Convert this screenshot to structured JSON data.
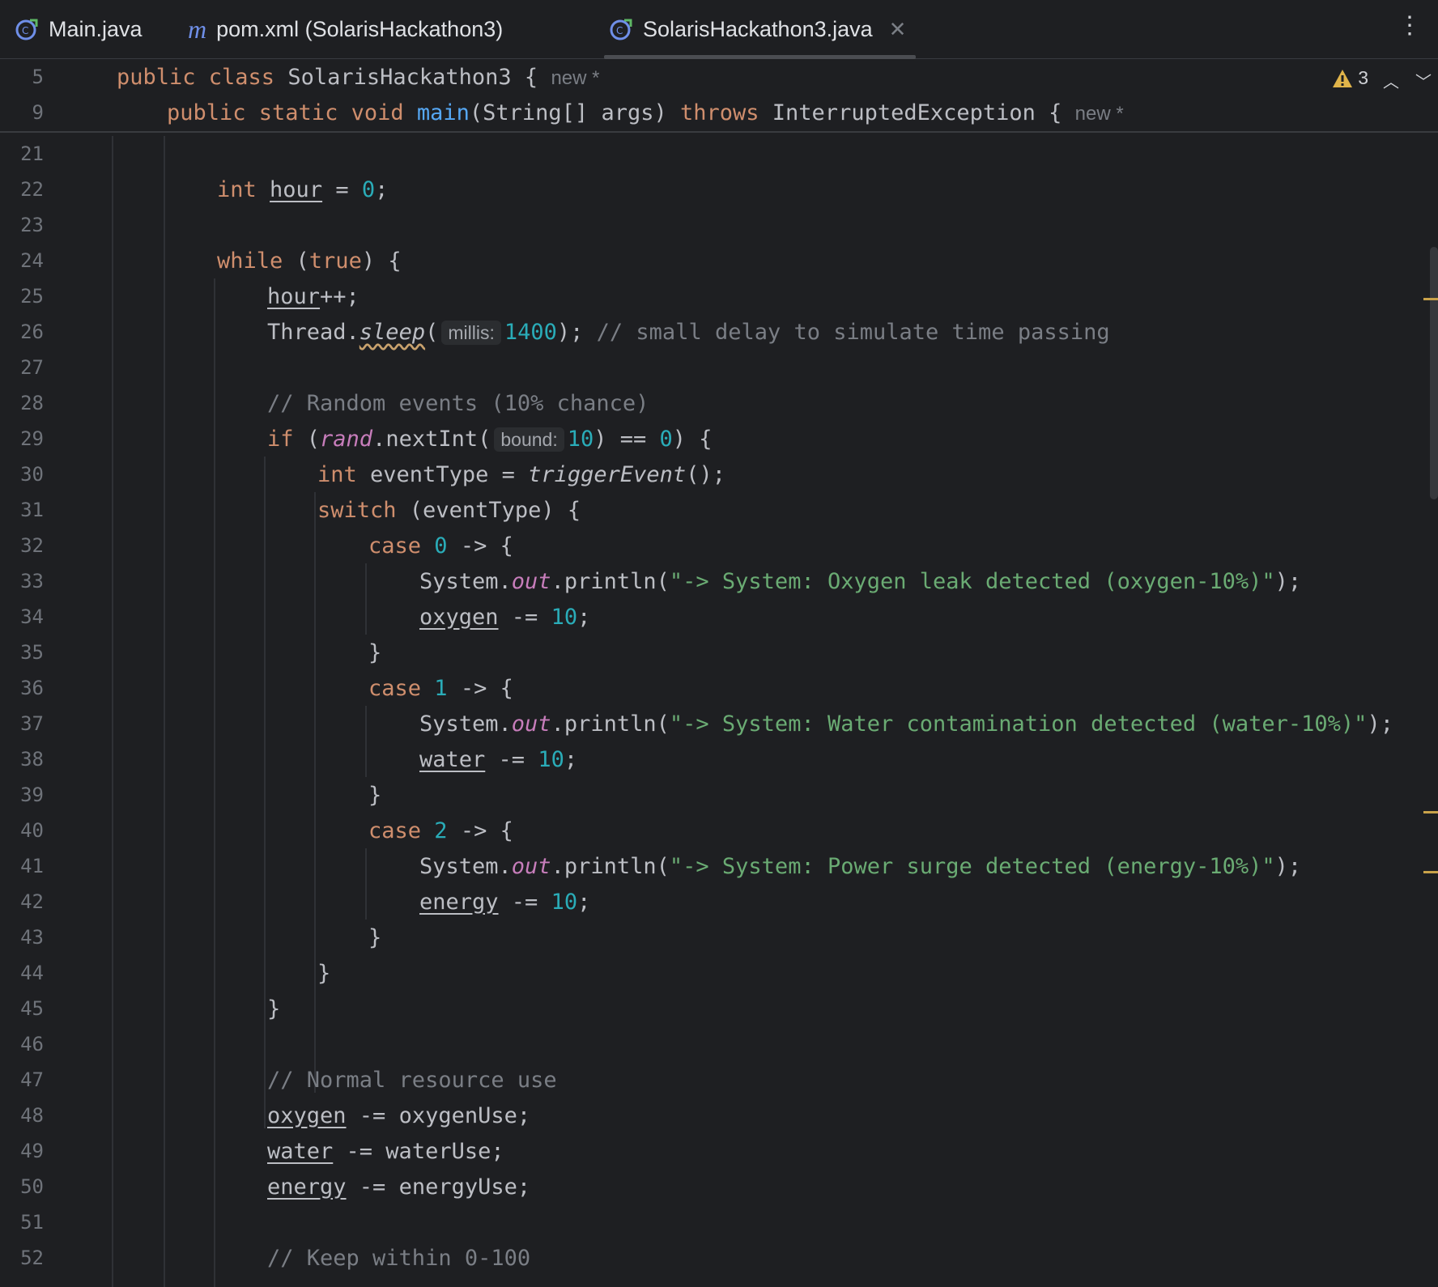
{
  "tabs": [
    {
      "label": "Main.java",
      "icon": "java-class-icon",
      "active": false
    },
    {
      "label": "pom.xml (SolarisHackathon3)",
      "icon": "maven-icon",
      "active": false
    },
    {
      "label": "SolarisHackathon3.java",
      "icon": "java-class-icon",
      "active": true
    }
  ],
  "inspections": {
    "warning_count": "3"
  },
  "sticky": {
    "line1": {
      "no": "5",
      "a": "public class ",
      "b": "SolarisHackathon3 {",
      "hint": "new *"
    },
    "line2": {
      "no": "9",
      "a": "public static void ",
      "b": "main",
      "c": "(String[] args) ",
      "d": "throws",
      "e": " InterruptedException {",
      "hint": "new *"
    }
  },
  "code": {
    "l22": {
      "kw": "int",
      "var": "hour",
      "rest": " = ",
      "num": "0",
      "end": ";"
    },
    "l24": {
      "kw": "while",
      "a": " (",
      "kw2": "true",
      "b": ") {"
    },
    "l25": {
      "var": "hour",
      "rest": "++;"
    },
    "l26": {
      "a": "Thread.",
      "m": "sleep",
      "b": "(",
      "hint": "millis:",
      "num": "1400",
      "c": "); ",
      "cmt": "// small delay to simulate time passing"
    },
    "l28": {
      "cmt": "// Random events (10% chance)"
    },
    "l29": {
      "kw": "if",
      "a": " (",
      "f": "rand",
      "b": ".nextInt(",
      "hint": "bound:",
      "num": "10",
      "c": ") == ",
      "num2": "0",
      "d": ") {"
    },
    "l30": {
      "kw": "int",
      "a": " eventType = ",
      "m": "triggerEvent",
      "b": "();"
    },
    "l31": {
      "kw": "switch",
      "a": " (eventType) {"
    },
    "l32": {
      "kw": "case",
      "num": "0",
      "a": " -> {"
    },
    "l33": {
      "a": "System.",
      "f": "out",
      "b": ".println(",
      "s": "\"-> System: Oxygen leak detected (oxygen-10%)\"",
      "c": ");"
    },
    "l34": {
      "var": "oxygen",
      "a": " -= ",
      "num": "10",
      "b": ";"
    },
    "l35": {
      "a": "}"
    },
    "l36": {
      "kw": "case",
      "num": "1",
      "a": " -> {"
    },
    "l37": {
      "a": "System.",
      "f": "out",
      "b": ".println(",
      "s": "\"-> System: Water contamination detected (water-10%)\"",
      "c": ");"
    },
    "l38": {
      "var": "water",
      "a": " -= ",
      "num": "10",
      "b": ";"
    },
    "l39": {
      "a": "}"
    },
    "l40": {
      "kw": "case",
      "num": "2",
      "a": " -> {"
    },
    "l41": {
      "a": "System.",
      "f": "out",
      "b": ".println(",
      "s": "\"-> System: Power surge detected (energy-10%)\"",
      "c": ");"
    },
    "l42": {
      "var": "energy",
      "a": " -= ",
      "num": "10",
      "b": ";"
    },
    "l43": {
      "a": "}"
    },
    "l44": {
      "a": "}"
    },
    "l45": {
      "a": "}"
    },
    "l47": {
      "cmt": "// Normal resource use"
    },
    "l48": {
      "var": "oxygen",
      "a": " -= oxygenUse;"
    },
    "l49": {
      "var": "water",
      "a": " -= waterUse;"
    },
    "l50": {
      "var": "energy",
      "a": " -= energyUse;"
    },
    "l52": {
      "cmt": "// Keep within 0-100"
    }
  },
  "line_numbers": [
    "21",
    "22",
    "23",
    "24",
    "25",
    "26",
    "27",
    "28",
    "29",
    "30",
    "31",
    "32",
    "33",
    "34",
    "35",
    "36",
    "37",
    "38",
    "39",
    "40",
    "41",
    "42",
    "43",
    "44",
    "45",
    "46",
    "47",
    "48",
    "49",
    "50",
    "51",
    "52"
  ],
  "colors": {
    "background": "#1e1f22",
    "keyword": "#cf8e6d",
    "number": "#2aacb8",
    "string": "#6aab73",
    "comment": "#7a7e85",
    "function": "#56a8f5",
    "static_field": "#c77dbb"
  }
}
